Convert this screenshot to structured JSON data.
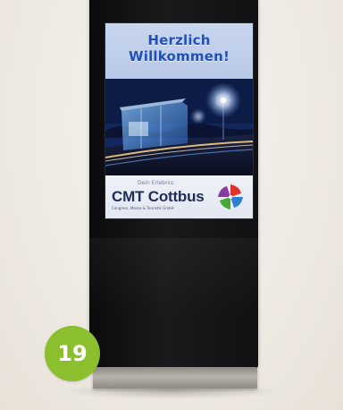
{
  "screen": {
    "headline_line1": "Herzlich",
    "headline_line2": "Willkommen!",
    "tagline": "Dein Erlebnis:",
    "brand_name": "CMT Cottbus",
    "brand_subline": "Congress, Messe & Touristik GmbH",
    "logo_icon": "cmt-pinwheel-logo",
    "photo_subject": "night-glass-bus-stop-photo"
  },
  "badge": {
    "number": "19",
    "color": "#8cbf2e"
  },
  "colors": {
    "headline": "#1f4fb8",
    "brand_text": "#1e2d57",
    "kiosk": "#111113",
    "background": "#f1ede7"
  }
}
